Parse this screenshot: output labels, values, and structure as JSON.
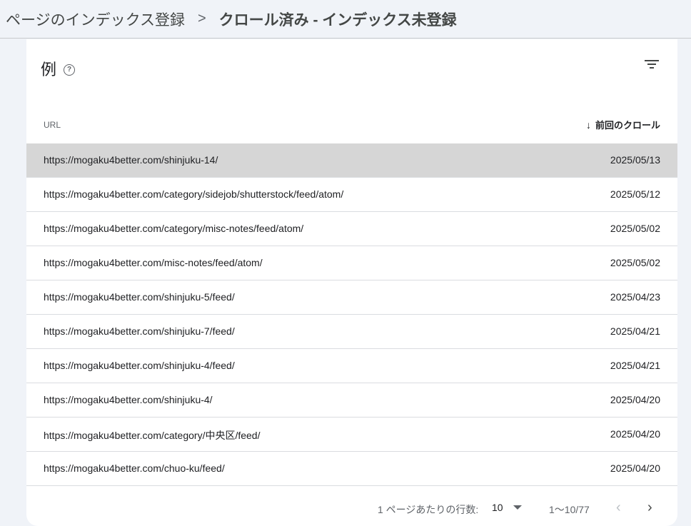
{
  "breadcrumb": {
    "parent": "ページのインデックス登録",
    "separator": ">",
    "current": "クロール済み - インデックス未登録"
  },
  "card": {
    "title": "例",
    "help_glyph": "?"
  },
  "table": {
    "columns": {
      "url": "URL",
      "date": "前回のクロール",
      "sort_glyph": "↓"
    },
    "rows": [
      {
        "url": "https://mogaku4better.com/shinjuku-14/",
        "date": "2025/05/13"
      },
      {
        "url": "https://mogaku4better.com/category/sidejob/shutterstock/feed/atom/",
        "date": "2025/05/12"
      },
      {
        "url": "https://mogaku4better.com/category/misc-notes/feed/atom/",
        "date": "2025/05/02"
      },
      {
        "url": "https://mogaku4better.com/misc-notes/feed/atom/",
        "date": "2025/05/02"
      },
      {
        "url": "https://mogaku4better.com/shinjuku-5/feed/",
        "date": "2025/04/23"
      },
      {
        "url": "https://mogaku4better.com/shinjuku-7/feed/",
        "date": "2025/04/21"
      },
      {
        "url": "https://mogaku4better.com/shinjuku-4/feed/",
        "date": "2025/04/21"
      },
      {
        "url": "https://mogaku4better.com/shinjuku-4/",
        "date": "2025/04/20"
      },
      {
        "url": "https://mogaku4better.com/category/中央区/feed/",
        "date": "2025/04/20"
      },
      {
        "url": "https://mogaku4better.com/chuo-ku/feed/",
        "date": "2025/04/20"
      }
    ]
  },
  "pager": {
    "rows_per_page_label": "1 ページあたりの行数:",
    "rows_per_page_value": "10",
    "range": "1〜10/77",
    "prev_glyph": "‹",
    "next_glyph": "›"
  },
  "colors": {
    "selected_row": "#d6d6d6",
    "background": "#f0f3f8",
    "card": "#ffffff"
  }
}
